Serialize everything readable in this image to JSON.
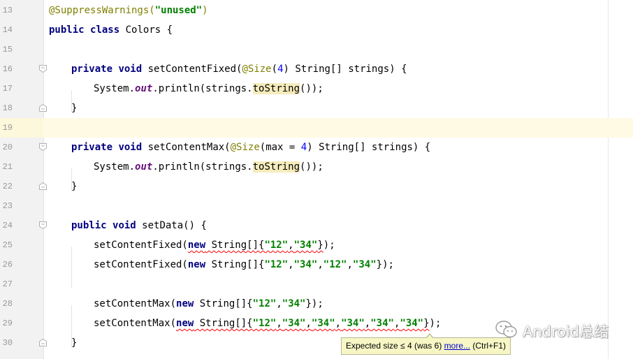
{
  "editor": {
    "current_line": "19",
    "lines": [
      {
        "num": "13",
        "indent": 0,
        "fold": null,
        "tokens": [
          {
            "t": "@SuppressWarnings(",
            "c": "ann"
          },
          {
            "t": "\"unused\"",
            "c": "str"
          },
          {
            "t": ")",
            "c": "ann"
          }
        ]
      },
      {
        "num": "14",
        "indent": 0,
        "fold": null,
        "tokens": [
          {
            "t": "public",
            "c": "kw"
          },
          {
            "t": " "
          },
          {
            "t": "class",
            "c": "kw"
          },
          {
            "t": " Colors {"
          }
        ]
      },
      {
        "num": "15",
        "indent": 0,
        "fold": null,
        "tokens": []
      },
      {
        "num": "16",
        "indent": 1,
        "fold": "start",
        "tokens": [
          {
            "t": "private",
            "c": "kw"
          },
          {
            "t": " "
          },
          {
            "t": "void",
            "c": "kw"
          },
          {
            "t": " setContentFixed("
          },
          {
            "t": "@Size",
            "c": "ann"
          },
          {
            "t": "("
          },
          {
            "t": "4",
            "c": "num"
          },
          {
            "t": ") String[] strings) {"
          }
        ]
      },
      {
        "num": "17",
        "indent": 2,
        "fold": null,
        "tokens": [
          {
            "t": "System."
          },
          {
            "t": "out",
            "c": "fld"
          },
          {
            "t": ".println(strings."
          },
          {
            "t": "toString",
            "c": "hl"
          },
          {
            "t": "());"
          }
        ]
      },
      {
        "num": "18",
        "indent": 1,
        "fold": "end",
        "tokens": [
          {
            "t": "}"
          }
        ]
      },
      {
        "num": "19",
        "indent": 0,
        "fold": null,
        "tokens": []
      },
      {
        "num": "20",
        "indent": 1,
        "fold": "start",
        "tokens": [
          {
            "t": "private",
            "c": "kw"
          },
          {
            "t": " "
          },
          {
            "t": "void",
            "c": "kw"
          },
          {
            "t": " setContentMax("
          },
          {
            "t": "@Size",
            "c": "ann"
          },
          {
            "t": "(max = "
          },
          {
            "t": "4",
            "c": "num"
          },
          {
            "t": ") String[] strings) {"
          }
        ]
      },
      {
        "num": "21",
        "indent": 2,
        "fold": null,
        "tokens": [
          {
            "t": "System."
          },
          {
            "t": "out",
            "c": "fld"
          },
          {
            "t": ".println(strings."
          },
          {
            "t": "toString",
            "c": "hl"
          },
          {
            "t": "());"
          }
        ]
      },
      {
        "num": "22",
        "indent": 1,
        "fold": "end",
        "tokens": [
          {
            "t": "}"
          }
        ]
      },
      {
        "num": "23",
        "indent": 0,
        "fold": null,
        "tokens": []
      },
      {
        "num": "24",
        "indent": 1,
        "fold": "start",
        "tokens": [
          {
            "t": "public",
            "c": "kw"
          },
          {
            "t": " "
          },
          {
            "t": "void",
            "c": "kw"
          },
          {
            "t": " setData() {"
          }
        ]
      },
      {
        "num": "25",
        "indent": 2,
        "fold": null,
        "tokens": [
          {
            "t": "setContentFixed("
          },
          {
            "t": "new",
            "c": "kw",
            "w": true
          },
          {
            "t": " String[]{",
            "w": true
          },
          {
            "t": "\"12\"",
            "c": "str",
            "w": true
          },
          {
            "t": ",",
            "w": true
          },
          {
            "t": "\"34\"",
            "c": "str",
            "w": true
          },
          {
            "t": "}",
            "w": true
          },
          {
            "t": ");"
          }
        ]
      },
      {
        "num": "26",
        "indent": 2,
        "fold": null,
        "tokens": [
          {
            "t": "setContentFixed("
          },
          {
            "t": "new",
            "c": "kw"
          },
          {
            "t": " String[]{"
          },
          {
            "t": "\"12\"",
            "c": "str"
          },
          {
            "t": ","
          },
          {
            "t": "\"34\"",
            "c": "str"
          },
          {
            "t": ","
          },
          {
            "t": "\"12\"",
            "c": "str"
          },
          {
            "t": ","
          },
          {
            "t": "\"34\"",
            "c": "str"
          },
          {
            "t": "});"
          }
        ]
      },
      {
        "num": "27",
        "indent": 0,
        "fold": null,
        "tokens": []
      },
      {
        "num": "28",
        "indent": 2,
        "fold": null,
        "tokens": [
          {
            "t": "setContentMax("
          },
          {
            "t": "new",
            "c": "kw"
          },
          {
            "t": " String[]{"
          },
          {
            "t": "\"12\"",
            "c": "str"
          },
          {
            "t": ","
          },
          {
            "t": "\"34\"",
            "c": "str"
          },
          {
            "t": "});"
          }
        ]
      },
      {
        "num": "29",
        "indent": 2,
        "fold": null,
        "tokens": [
          {
            "t": "setContentMax("
          },
          {
            "t": "new",
            "c": "kw",
            "w": true
          },
          {
            "t": " String[]{",
            "w": true
          },
          {
            "t": "\"12\"",
            "c": "str",
            "w": true
          },
          {
            "t": ",",
            "w": true
          },
          {
            "t": "\"34\"",
            "c": "str",
            "w": true
          },
          {
            "t": ",",
            "w": true
          },
          {
            "t": "\"34\"",
            "c": "str",
            "w": true
          },
          {
            "t": ",",
            "w": true
          },
          {
            "t": "\"34\"",
            "c": "str",
            "w": true
          },
          {
            "t": ",",
            "w": true
          },
          {
            "t": "\"34\"",
            "c": "str",
            "w": true
          },
          {
            "t": ",",
            "w": true
          },
          {
            "t": "\"34\"",
            "c": "str",
            "w": true
          },
          {
            "t": "}",
            "w": true
          },
          {
            "t": ");"
          }
        ]
      },
      {
        "num": "30",
        "indent": 1,
        "fold": "end",
        "tokens": [
          {
            "t": "}"
          }
        ]
      }
    ]
  },
  "tooltip": {
    "message": "Expected size ≤ 4 (was 6) ",
    "link": "more...",
    "shortcut": " (Ctrl+F1)"
  },
  "watermark": {
    "icon": "wechat-icon",
    "text": "Android总结"
  },
  "colors": {
    "keyword": "#000080",
    "annotation": "#808000",
    "string": "#008000",
    "number": "#0000ff",
    "field": "#660e7a",
    "current_line_bg": "#fffae3",
    "tooltip_bg": "#f7f7c6"
  }
}
